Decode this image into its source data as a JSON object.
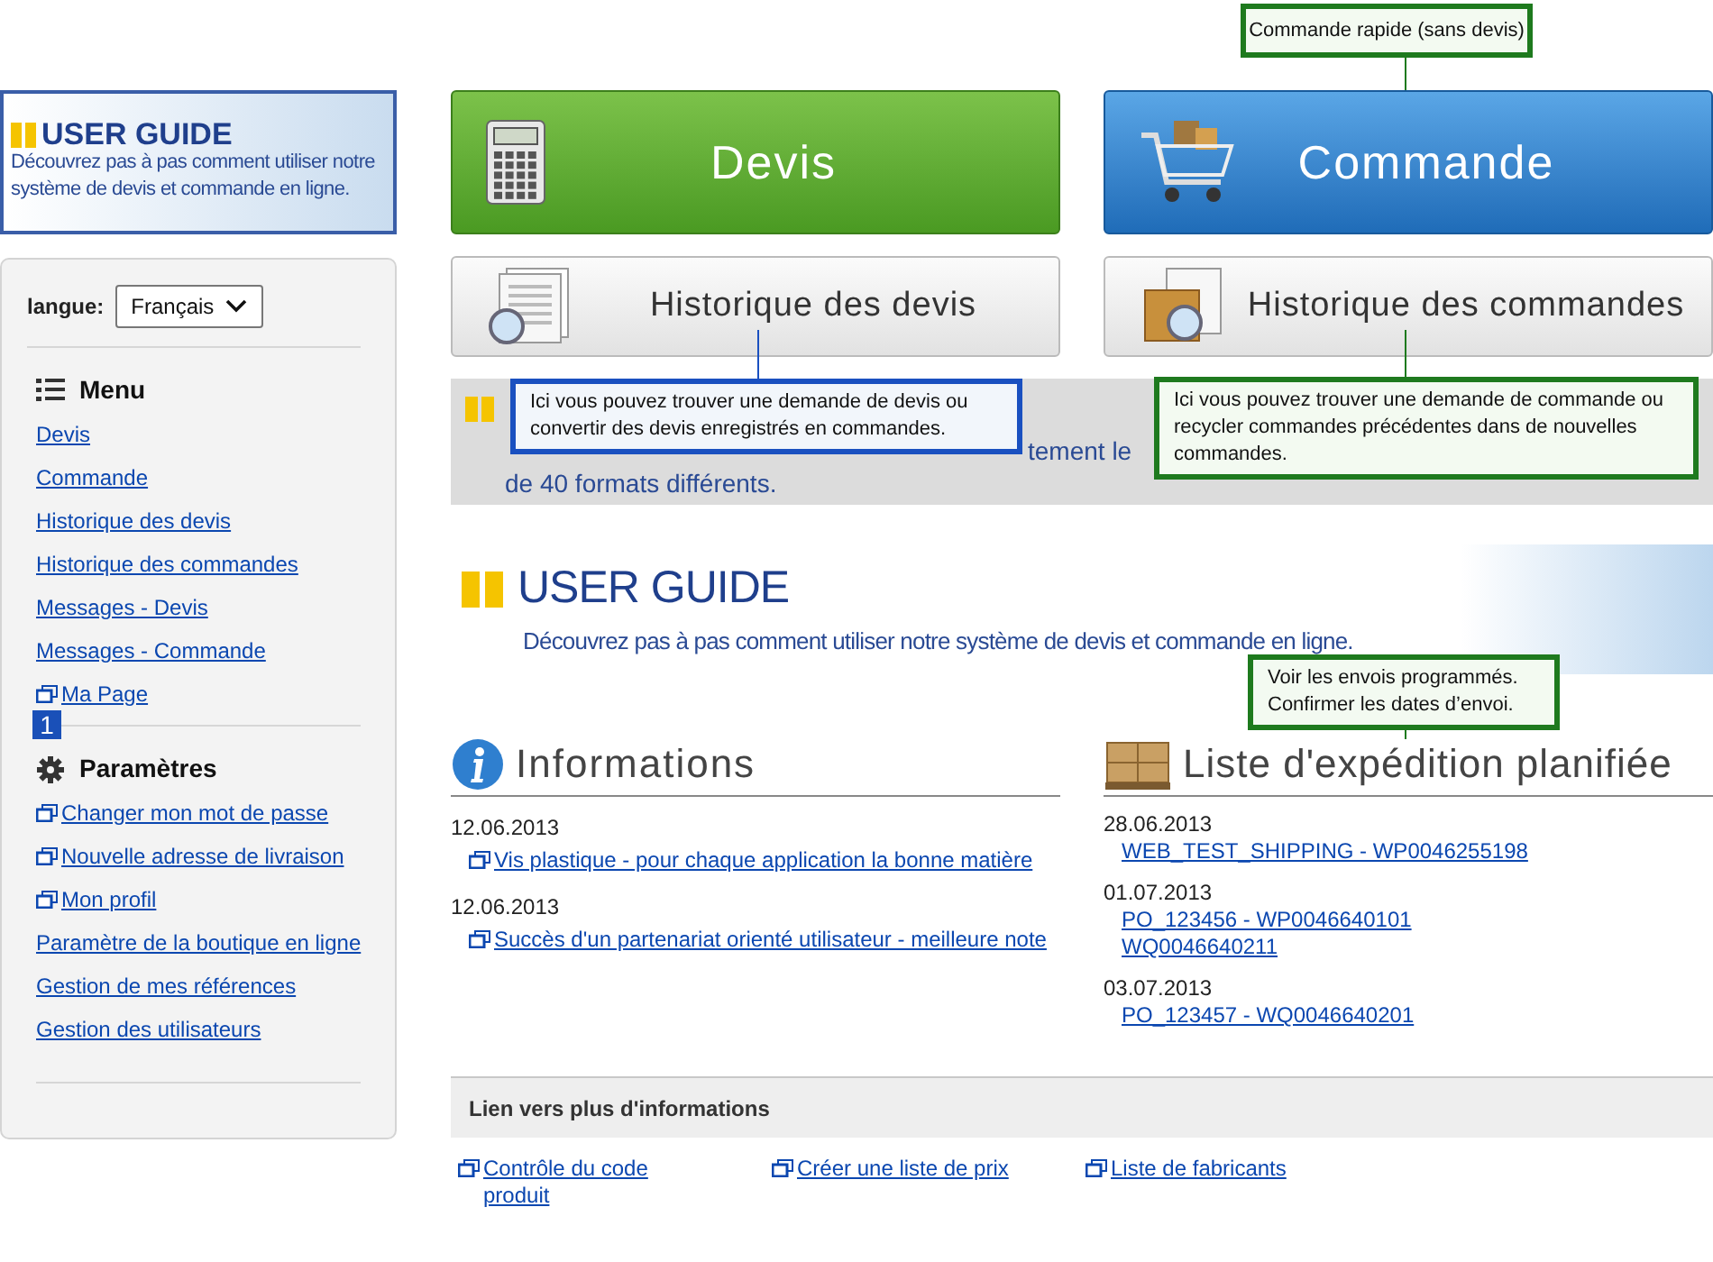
{
  "user_guide_banner": {
    "title": "USER GUIDE",
    "text": "Découvrez pas à pas comment utiliser notre système de devis et commande en ligne."
  },
  "language": {
    "label": "langue:",
    "value": "Français"
  },
  "menu": {
    "title": "Menu",
    "items": [
      {
        "label": "Devis",
        "external": false
      },
      {
        "label": "Commande",
        "external": false
      },
      {
        "label": "Historique des devis",
        "external": false
      },
      {
        "label": "Historique des commandes",
        "external": false
      },
      {
        "label": "Messages - Devis",
        "external": false
      },
      {
        "label": "Messages - Commande",
        "external": false
      },
      {
        "label": "Ma Page",
        "external": true
      }
    ]
  },
  "step_badge": "1",
  "settings": {
    "title": "Paramètres",
    "items": [
      {
        "label": "Changer mon mot de passe",
        "external": true
      },
      {
        "label": "Nouvelle adresse de livraison",
        "external": true
      },
      {
        "label": "Mon profil",
        "external": true
      },
      {
        "label": "Paramètre de la boutique en ligne",
        "external": false
      },
      {
        "label": "Gestion de mes références",
        "external": false
      },
      {
        "label": "Gestion des utilisateurs",
        "external": false
      }
    ]
  },
  "action_buttons": [
    {
      "kind": "quote",
      "label": "Devis"
    },
    {
      "kind": "order",
      "label": "Commande"
    },
    {
      "kind": "quote_history",
      "label": "Historique des devis"
    },
    {
      "kind": "order_history",
      "label": "Historique des commandes"
    }
  ],
  "promo_banner": {
    "texts": [
      "tement le",
      "de 40 formats différents."
    ]
  },
  "tooltips": [
    {
      "kind": "green",
      "text": "Commande rapide (sans devis)"
    },
    {
      "kind": "blue",
      "text": "Ici vous pouvez trouver une demande de devis ou convertir des devis enregistrés en commandes."
    },
    {
      "kind": "green",
      "text": "Ici vous pouvez trouver une demande de commande ou recycler commandes précédentes dans de nouvelles commandes."
    },
    {
      "kind": "green",
      "text": "Voir les envois programmés. Confirmer les dates d’envoi."
    }
  ],
  "user_guide": {
    "title": "USER GUIDE",
    "subtitle": "Découvrez pas à pas comment utiliser notre système de devis et commande en ligne."
  },
  "informations": {
    "title": "Informations",
    "entries": [
      {
        "date": "12.06.2013",
        "link": "Vis plastique - pour chaque application la bonne matière"
      },
      {
        "date": "12.06.2013",
        "link": "Succès d'un partenariat orienté utilisateur - meilleure note"
      }
    ]
  },
  "shipping": {
    "title": "Liste d'expédition planifiée",
    "entries": [
      {
        "date": "28.06.2013",
        "links": [
          "WEB_TEST_SHIPPING - WP0046255198"
        ]
      },
      {
        "date": "01.07.2013",
        "links": [
          "PO_123456 - WP0046640101",
          "WQ0046640211"
        ]
      },
      {
        "date": "03.07.2013",
        "links": [
          "PO_123457 - WQ0046640201"
        ]
      }
    ]
  },
  "more_info": {
    "title": "Lien vers plus d'informations",
    "links": [
      "Contrôle du code produit",
      "Créer une liste de prix",
      "Liste de fabricants"
    ]
  }
}
